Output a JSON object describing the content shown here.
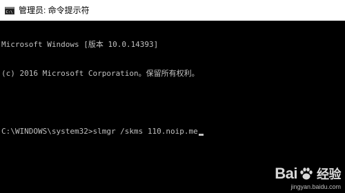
{
  "window": {
    "title": "管理员: 命令提示符",
    "icon": "cmd-icon"
  },
  "console": {
    "lines": [
      "Microsoft Windows [版本 10.0.14393]",
      "(c) 2016 Microsoft Corporation。保留所有权利。",
      "",
      "C:\\WINDOWS\\system32>slmgr /skms 110.noip.me"
    ]
  },
  "watermark": {
    "brand": "Bai",
    "brand_suffix": "经验",
    "url": "jingyan.baidu.com"
  },
  "colors": {
    "console_bg": "#000000",
    "console_text": "#c0c0c0",
    "titlebar_bg": "#ffffff"
  }
}
